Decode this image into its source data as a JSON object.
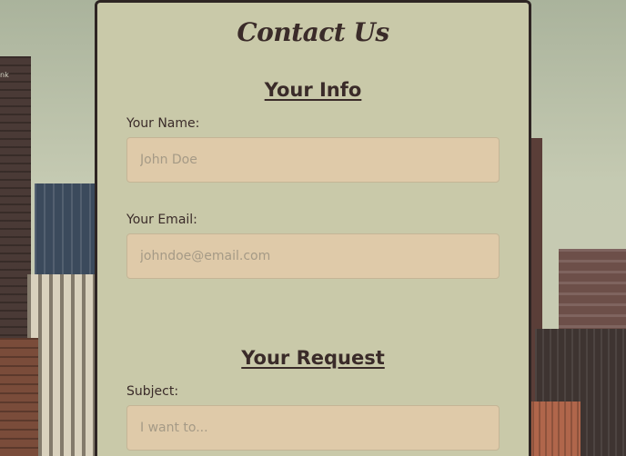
{
  "header": {
    "title": "Contact Us"
  },
  "sections": {
    "info_title": "Your Info",
    "request_title": "Your Request"
  },
  "fields": {
    "name": {
      "label": "Your Name:",
      "placeholder": "John Doe",
      "value": ""
    },
    "email": {
      "label": "Your Email:",
      "placeholder": "johndoe@email.com",
      "value": ""
    },
    "subject": {
      "label": "Subject:",
      "placeholder": "I want to...",
      "value": ""
    }
  },
  "background": {
    "sign_text": "nk"
  },
  "colors": {
    "panel_bg": "#c9c9a9",
    "panel_border": "#2e2523",
    "input_bg": "#dfcaa9",
    "text": "#3a2b29",
    "placeholder": "#a59a86"
  }
}
